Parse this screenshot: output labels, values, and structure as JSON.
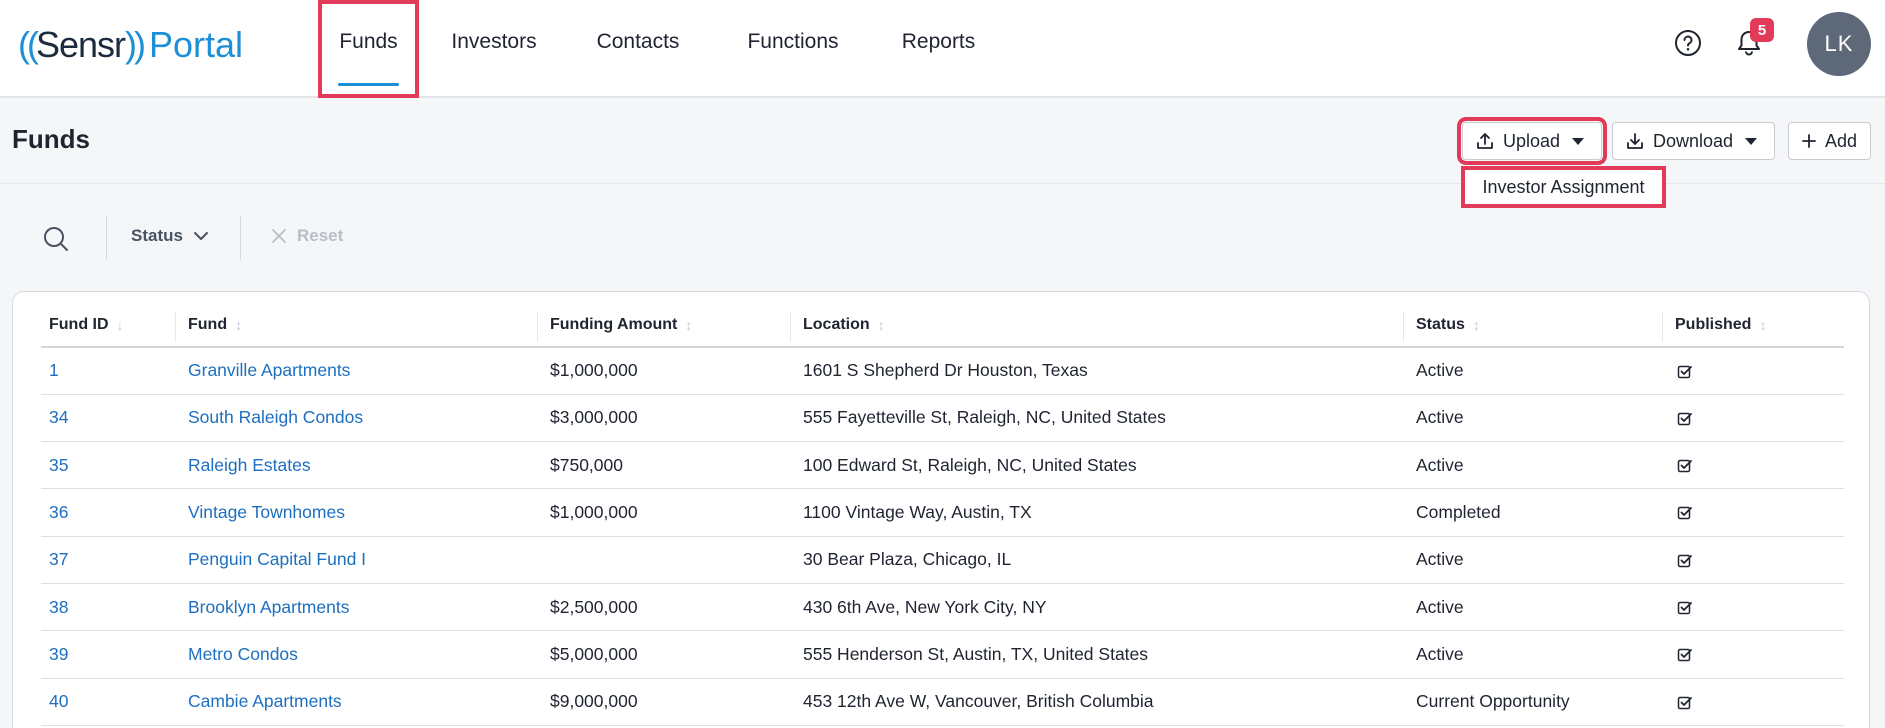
{
  "app": {
    "logo_waves_left": "((",
    "logo_brand": "Sensr",
    "logo_waves_right": "))",
    "logo_portal": "Portal"
  },
  "nav": {
    "items": [
      {
        "label": "Funds",
        "active": true
      },
      {
        "label": "Investors"
      },
      {
        "label": "Contacts"
      },
      {
        "label": "Functions"
      },
      {
        "label": "Reports"
      }
    ]
  },
  "header": {
    "notification_count": "5",
    "avatar_initials": "LK"
  },
  "page": {
    "title": "Funds",
    "upload_label": "Upload",
    "download_label": "Download",
    "add_label": "Add",
    "upload_menu": [
      "Investor Assignment"
    ]
  },
  "filters": {
    "status_label": "Status",
    "reset_label": "Reset"
  },
  "table": {
    "columns": [
      "Fund ID",
      "Fund",
      "Funding Amount",
      "Location",
      "Status",
      "Published"
    ],
    "rows": [
      {
        "id": "1",
        "fund": "Granville Apartments",
        "amount": "$1,000,000",
        "location": "1601 S Shepherd Dr Houston, Texas",
        "status": "Active",
        "published": true
      },
      {
        "id": "34",
        "fund": "South Raleigh Condos",
        "amount": "$3,000,000",
        "location": "555 Fayetteville St, Raleigh, NC, United States",
        "status": "Active",
        "published": true
      },
      {
        "id": "35",
        "fund": "Raleigh Estates",
        "amount": "$750,000",
        "location": "100 Edward St, Raleigh, NC, United States",
        "status": "Active",
        "published": true
      },
      {
        "id": "36",
        "fund": "Vintage Townhomes",
        "amount": "$1,000,000",
        "location": "1100 Vintage Way, Austin, TX",
        "status": "Completed",
        "published": true
      },
      {
        "id": "37",
        "fund": "Penguin Capital Fund I",
        "amount": "",
        "location": "30 Bear Plaza, Chicago, IL",
        "status": "Active",
        "published": true
      },
      {
        "id": "38",
        "fund": "Brooklyn Apartments",
        "amount": "$2,500,000",
        "location": "430 6th Ave, New York City, NY",
        "status": "Active",
        "published": true
      },
      {
        "id": "39",
        "fund": "Metro Condos",
        "amount": "$5,000,000",
        "location": "555 Henderson St, Austin, TX, United States",
        "status": "Active",
        "published": true
      },
      {
        "id": "40",
        "fund": "Cambie Apartments",
        "amount": "$9,000,000",
        "location": "453 12th Ave W, Vancouver, British Columbia",
        "status": "Current Opportunity",
        "published": true
      }
    ]
  },
  "colors": {
    "accent": "#1d8fd6",
    "link": "#1d6fc0",
    "highlight": "#e23b5a"
  }
}
